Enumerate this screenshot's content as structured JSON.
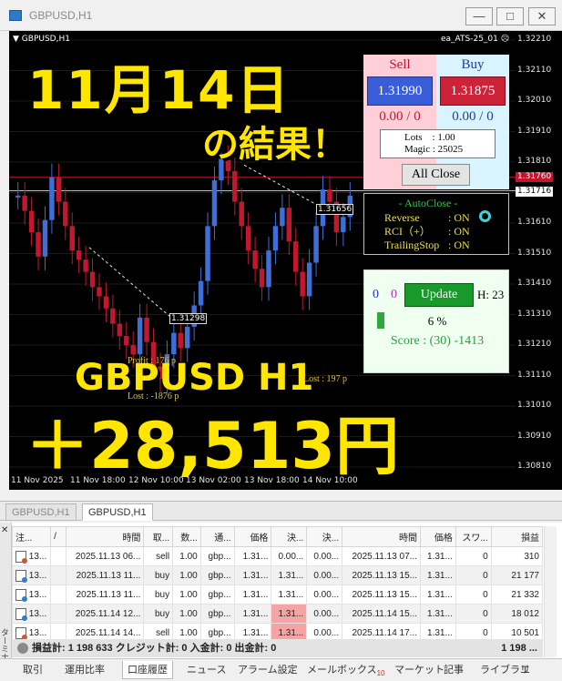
{
  "window": {
    "title": "GBPUSD,H1",
    "buttons": [
      "minimize",
      "restore",
      "close"
    ]
  },
  "chart": {
    "symbol_label": "GBPUSD,H1",
    "ea_label": "ea_ATS-25_01",
    "price_levels": [
      "1.32210",
      "1.32110",
      "1.32010",
      "1.31910",
      "1.31810",
      "1.31710",
      "1.31610",
      "1.31510",
      "1.31410",
      "1.31310",
      "1.31210",
      "1.31110",
      "1.31010",
      "1.30910",
      "1.30810"
    ],
    "time_labels": [
      "11 Nov 2025",
      "11 Nov 18:00",
      "12 Nov 10:00",
      "13 Nov 02:00",
      "13 Nov 18:00",
      "14 Nov 10:00"
    ],
    "bid_price": "1.31760",
    "ask_price": "1.31716",
    "trade_labels": [
      "1.31656",
      "1.31298"
    ],
    "profit_text": "Profit : 176 p",
    "lost_text": "Lost : -1876 p",
    "lost_text2": "Lost : 197 p",
    "overlay": {
      "date": "11月14日",
      "result": "の結果！",
      "pair": "GBPUSD H1",
      "amount": "＋28,513円"
    },
    "colors": {
      "bull": "#3d6fd6",
      "bear": "#c2182f",
      "overlay": "#ffe600"
    }
  },
  "panel": {
    "sell_label": "Sell",
    "buy_label": "Buy",
    "sell_price": "1.31990",
    "buy_price": "1.31875",
    "sell_count": "0.00 / 0",
    "buy_count": "0.00 / 0",
    "lots": "Lots　: 1.00",
    "magic": "Magic : 25025",
    "all_close": "All Close",
    "autoclose_title": "- AutoClose -",
    "autoclose": [
      {
        "name": "Reverse",
        "value": ": ON"
      },
      {
        "name": "RCI（+）",
        "value": ": ON"
      },
      {
        "name": "TrailingStop",
        "value": ": ON"
      }
    ],
    "count_a": "0",
    "count_b": "0",
    "update": "Update",
    "h_value": "H: 23",
    "percent": "6 %",
    "score": "Score : (30) -1413"
  },
  "terminal": {
    "chart_tabs": [
      "GBPUSD,H1",
      "GBPUSD,H1"
    ],
    "side_label": "ターミナル",
    "columns": [
      "注...",
      "/",
      "時間",
      "取...",
      "数...",
      "通...",
      "価格",
      "決...",
      "決...",
      "時間",
      "価格",
      "スワ...",
      "損益"
    ],
    "rows": [
      [
        "13...",
        "",
        "2025.11.13 06...",
        "sell",
        "1.00",
        "gbp...",
        "1.31...",
        "0.00...",
        "0.00...",
        "2025.11.13 07...",
        "1.31...",
        "0",
        "310"
      ],
      [
        "13...",
        "",
        "2025.11.13 11...",
        "buy",
        "1.00",
        "gbp...",
        "1.31...",
        "1.31...",
        "0.00...",
        "2025.11.13 15...",
        "1.31...",
        "0",
        "21 177"
      ],
      [
        "13...",
        "",
        "2025.11.13 11...",
        "buy",
        "1.00",
        "gbp...",
        "1.31...",
        "1.31...",
        "0.00...",
        "2025.11.13 15...",
        "1.31...",
        "0",
        "21 332"
      ],
      [
        "13...",
        "",
        "2025.11.14 12...",
        "buy",
        "1.00",
        "gbp...",
        "1.31...",
        "1.31...",
        "0.00...",
        "2025.11.14 15...",
        "1.31...",
        "0",
        "18 012"
      ],
      [
        "13...",
        "",
        "2025.11.14 14...",
        "sell",
        "1.00",
        "gbp...",
        "1.31...",
        "1.31...",
        "0.00...",
        "2025.11.14 17...",
        "1.31...",
        "0",
        "10 501"
      ]
    ],
    "summary": "損益計: 1 198 633  クレジット計: 0  入金計: 0  出金計: 0",
    "summary_total": "1 198 ...",
    "bottom_tabs": [
      "取引",
      "運用比率",
      "口座履歴",
      "ニュース",
      "アラーム設定",
      "メールボックス",
      "マーケット",
      "記事",
      "ライブラリ",
      "エ"
    ],
    "mail_badge": "10"
  }
}
